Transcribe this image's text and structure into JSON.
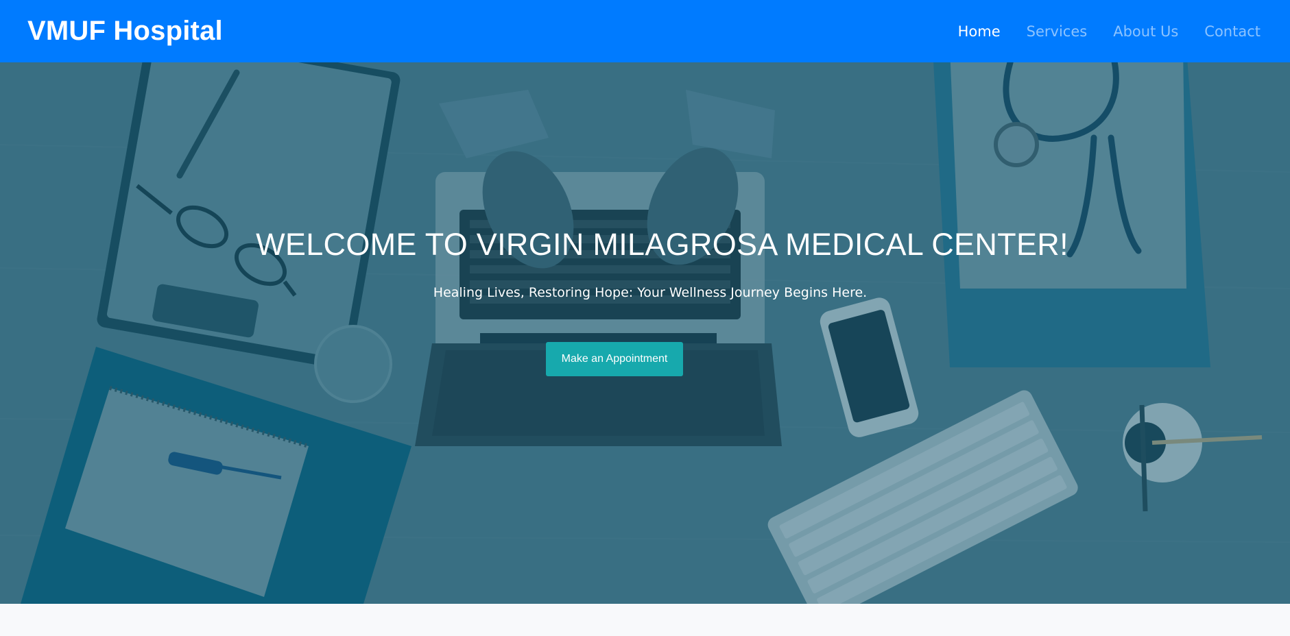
{
  "header": {
    "brand": "VMUF Hospital",
    "nav": [
      {
        "label": "Home",
        "active": true
      },
      {
        "label": "Services",
        "active": false
      },
      {
        "label": "About Us",
        "active": false
      },
      {
        "label": "Contact",
        "active": false
      }
    ]
  },
  "hero": {
    "title": "WELCOME TO VIRGIN MILAGROSA MEDICAL CENTER!",
    "subtitle": "Healing Lives, Restoring Hope: Your Wellness Journey Begins Here.",
    "cta_label": "Make an Appointment",
    "background_image": "doctor typing on laptop at desk with stethoscope, clipboard, glasses, thermometer, phone and keyboard"
  },
  "colors": {
    "navbar": "#007bff",
    "hero_overlay": "#2f6f86",
    "cta": "#17a9ad",
    "page_background": "#f8f9fb"
  }
}
